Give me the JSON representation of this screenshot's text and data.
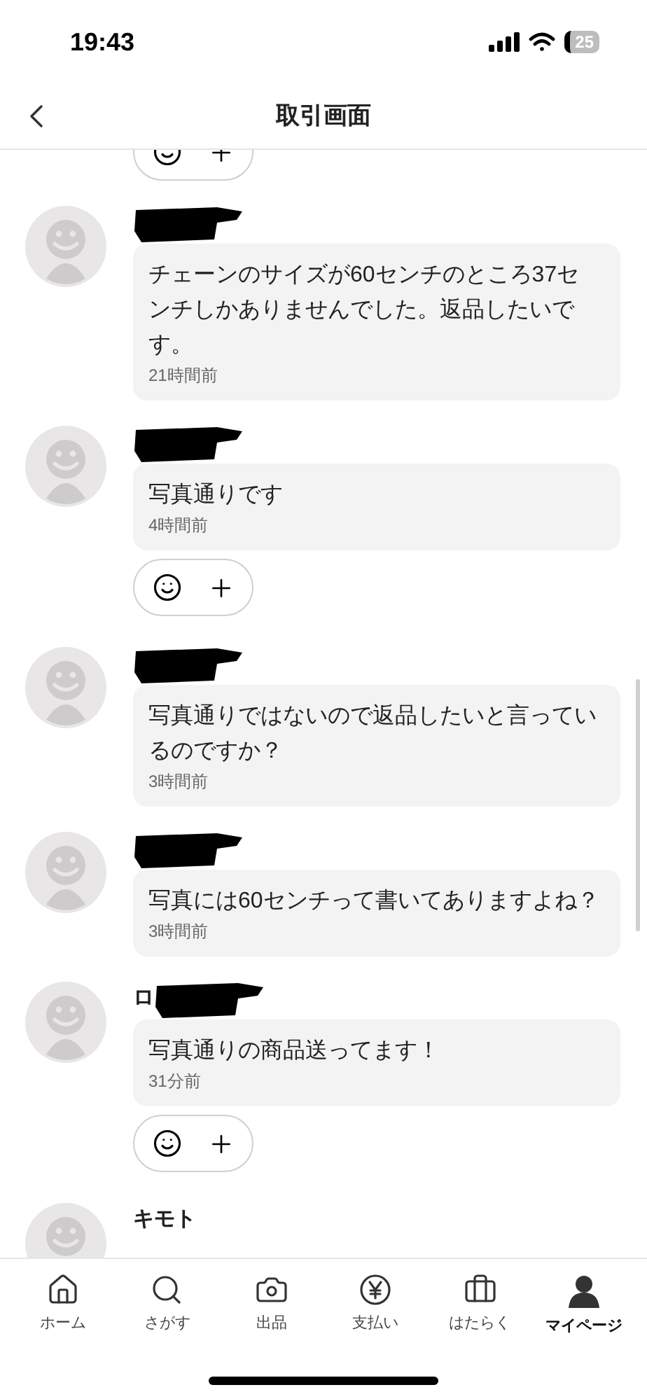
{
  "status_bar": {
    "time": "19:43",
    "battery": "25"
  },
  "header": {
    "title": "取引画面"
  },
  "top_reaction_bar": true,
  "messages": [
    {
      "name_hidden": true,
      "text": "チェーンのサイズが60センチのところ37センチしかありませんでした。返品したいです。",
      "time": "21時間前",
      "reaction_bar": false
    },
    {
      "name_hidden": true,
      "text": "写真通りです",
      "time": "4時間前",
      "reaction_bar": true
    },
    {
      "name_hidden": true,
      "text": "写真通りではないので返品したいと言っているのですか？",
      "time": "3時間前",
      "reaction_bar": false
    },
    {
      "name_hidden": true,
      "text": "写真には60センチって書いてありますよね？",
      "time": "3時間前",
      "reaction_bar": false
    },
    {
      "name": "ロ",
      "name_hidden": true,
      "text": "写真通りの商品送ってます！",
      "time": "31分前",
      "reaction_bar": true
    },
    {
      "name": "キモト",
      "name_hidden": false,
      "reaction_bar": false
    }
  ],
  "nav": [
    {
      "kind": "home",
      "label": "ホーム",
      "selected": false
    },
    {
      "kind": "search",
      "label": "さがす",
      "selected": false
    },
    {
      "kind": "camera",
      "label": "出品",
      "selected": false
    },
    {
      "kind": "yen",
      "label": "支払い",
      "selected": false
    },
    {
      "kind": "work",
      "label": "はたらく",
      "selected": false
    },
    {
      "kind": "person",
      "label": "マイページ",
      "selected": true
    }
  ]
}
